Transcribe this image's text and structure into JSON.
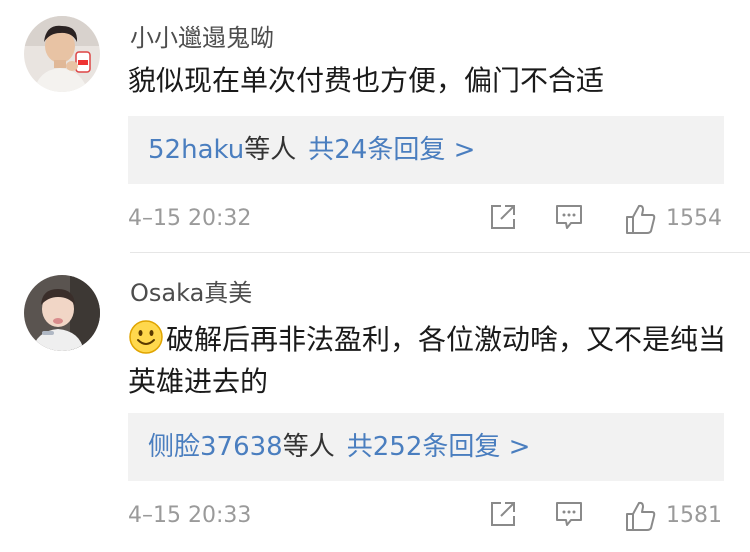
{
  "comments": [
    {
      "username": "小小邋遢鬼呦",
      "text": "貌似现在单次付费也方便，偏门不合适",
      "replies": {
        "first_user": "52haku",
        "deng_ren": "等人",
        "total_label": "共24条回复 >"
      },
      "timestamp": "4–15 20:32",
      "likes": "1554",
      "avatar_icon": "avatar-photo-icon"
    },
    {
      "username": "Osaka真美",
      "emoji": "smile-emoji-icon",
      "text": "破解后再非法盈利，各位激动啥，又不是纯当英雄进去的",
      "replies": {
        "first_user": "侧脸37638",
        "deng_ren": "等人",
        "total_label": "共252条回复 >"
      },
      "timestamp": "4–15 20:33",
      "likes": "1581",
      "avatar_icon": "avatar-photo-icon"
    }
  ],
  "colors": {
    "link": "#4a7ebf",
    "meta": "#9a9a9a",
    "reply_bg": "#f2f2f2",
    "text": "#1a1a1a"
  }
}
